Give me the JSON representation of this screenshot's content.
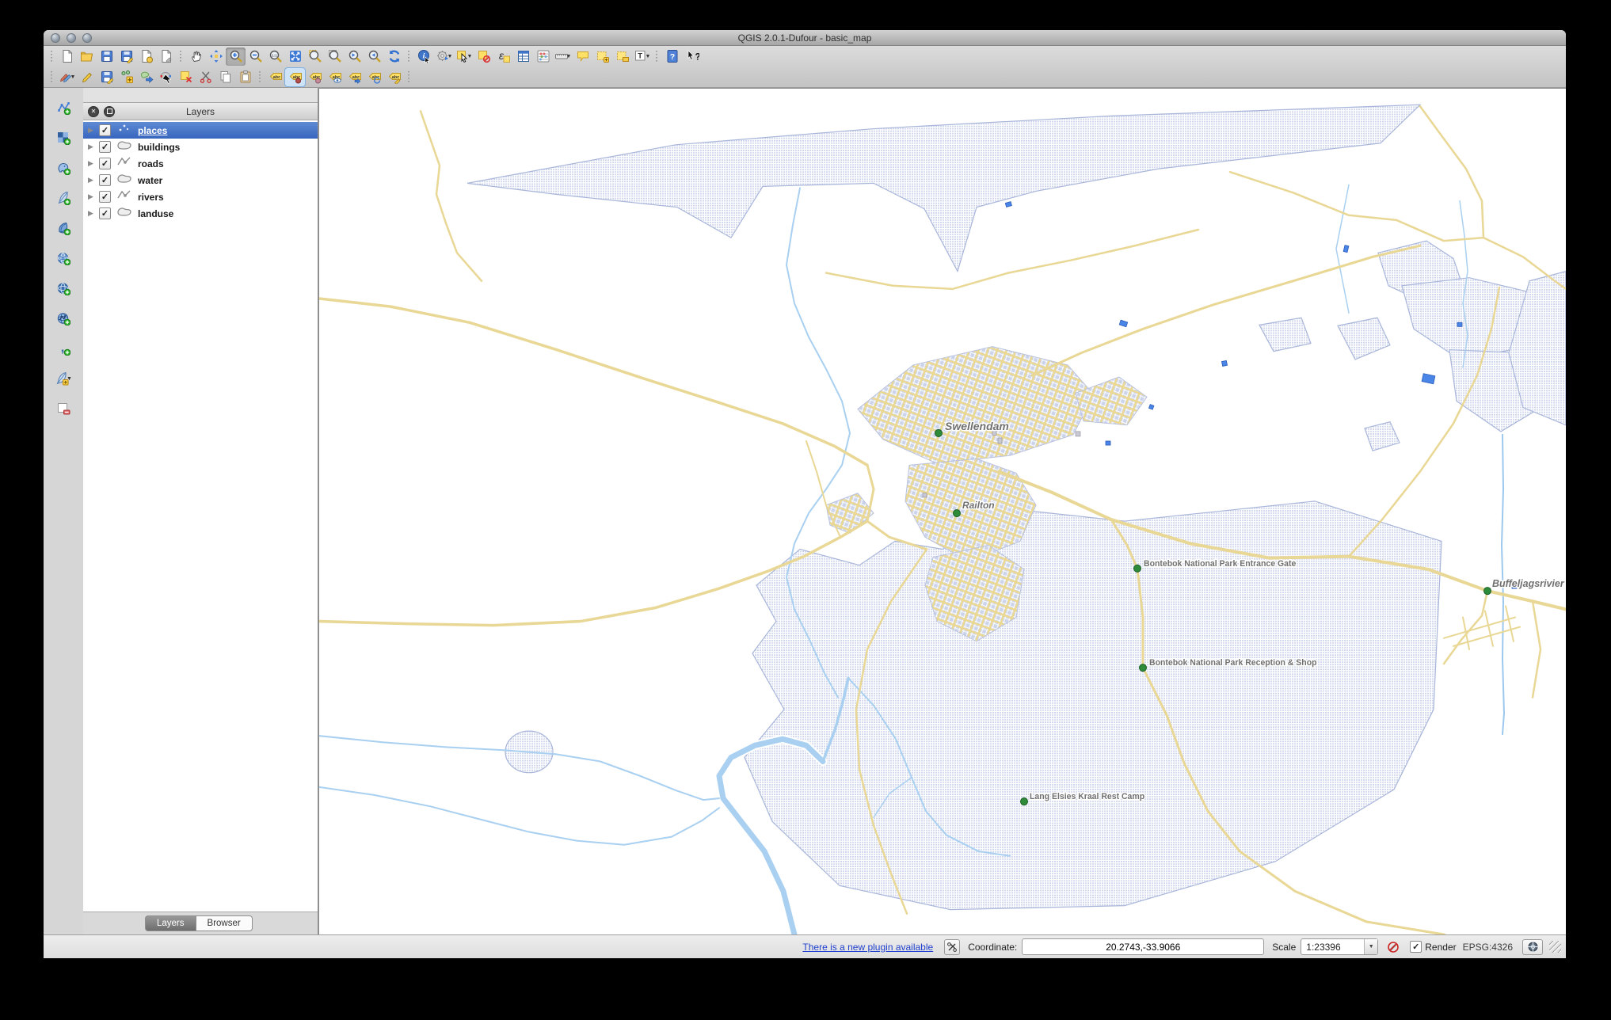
{
  "window": {
    "title": "QGIS 2.0.1-Dufour - basic_map"
  },
  "toolbars": {
    "row1": [
      {
        "grip": true
      },
      {
        "name": "new-project-icon"
      },
      {
        "name": "open-project-icon"
      },
      {
        "name": "save-project-icon"
      },
      {
        "name": "save-project-as-icon"
      },
      {
        "name": "new-composer-icon"
      },
      {
        "name": "composer-manager-icon"
      },
      {
        "grip": true
      },
      {
        "name": "pan-map-icon"
      },
      {
        "name": "pan-to-selection-icon"
      },
      {
        "name": "zoom-in-icon",
        "active": true
      },
      {
        "name": "zoom-out-icon"
      },
      {
        "name": "zoom-native-icon"
      },
      {
        "name": "zoom-full-icon"
      },
      {
        "name": "zoom-to-selection-icon"
      },
      {
        "name": "zoom-to-layer-icon"
      },
      {
        "name": "zoom-last-icon"
      },
      {
        "name": "zoom-next-icon"
      },
      {
        "name": "refresh-icon"
      },
      {
        "grip": true
      },
      {
        "name": "identify-icon"
      },
      {
        "name": "run-feature-action-icon",
        "dd": true
      },
      {
        "name": "select-features-icon",
        "dd": true
      },
      {
        "name": "deselect-features-icon"
      },
      {
        "name": "select-by-expression-icon"
      },
      {
        "name": "attribute-table-icon"
      },
      {
        "name": "field-calculator-icon"
      },
      {
        "name": "measure-icon",
        "dd": true
      },
      {
        "name": "map-tips-icon"
      },
      {
        "name": "new-bookmark-icon"
      },
      {
        "name": "show-bookmarks-icon"
      },
      {
        "name": "text-annotation-icon",
        "dd": true
      },
      {
        "grip": true
      },
      {
        "name": "help-icon"
      },
      {
        "name": "whats-this-icon"
      }
    ],
    "row2": [
      {
        "grip": true
      },
      {
        "name": "current-edits-icon",
        "dd": true
      },
      {
        "name": "toggle-editing-icon"
      },
      {
        "name": "save-layer-edits-icon"
      },
      {
        "name": "add-feature-icon"
      },
      {
        "name": "move-feature-icon"
      },
      {
        "name": "node-tool-icon"
      },
      {
        "name": "delete-selected-icon"
      },
      {
        "name": "cut-features-icon"
      },
      {
        "name": "copy-features-icon"
      },
      {
        "name": "paste-features-icon"
      },
      {
        "grip": true
      },
      {
        "name": "label-icon"
      },
      {
        "name": "pin-labels-icon",
        "active": true
      },
      {
        "name": "highlight-pinned-labels-icon"
      },
      {
        "name": "show-hide-labels-icon"
      },
      {
        "name": "move-label-icon"
      },
      {
        "name": "rotate-label-icon"
      },
      {
        "name": "change-label-icon"
      },
      {
        "grip": true
      }
    ],
    "left": [
      {
        "name": "add-vector-layer-icon"
      },
      {
        "name": "add-raster-layer-icon"
      },
      {
        "name": "add-postgis-layer-icon"
      },
      {
        "name": "add-spatialite-layer-icon"
      },
      {
        "name": "add-mssql-layer-icon"
      },
      {
        "name": "add-wms-layer-icon"
      },
      {
        "name": "add-wcs-layer-icon"
      },
      {
        "name": "add-wfs-layer-icon"
      },
      {
        "name": "add-delimited-text-layer-icon"
      },
      {
        "name": "new-shapefile-layer-icon",
        "dd": true
      },
      {
        "name": "remove-layer-icon"
      }
    ]
  },
  "layers_panel": {
    "title": "Layers",
    "layers": [
      {
        "label": "places",
        "type": "point",
        "checked": true,
        "selected": true
      },
      {
        "label": "buildings",
        "type": "polygon",
        "checked": true,
        "selected": false
      },
      {
        "label": "roads",
        "type": "line",
        "checked": true,
        "selected": false
      },
      {
        "label": "water",
        "type": "polygon",
        "checked": true,
        "selected": false
      },
      {
        "label": "rivers",
        "type": "line",
        "checked": true,
        "selected": false
      },
      {
        "label": "landuse",
        "type": "polygon",
        "checked": true,
        "selected": false
      }
    ],
    "tabs": [
      {
        "label": "Layers",
        "active": true
      },
      {
        "label": "Browser",
        "active": false
      }
    ]
  },
  "status_bar": {
    "plugin_link": "There is a new plugin available",
    "coordinate_label": "Coordinate:",
    "coordinate_value": "20.2743,-33.9066",
    "scale_label": "Scale",
    "scale_value": "1:23396",
    "render_label": "Render",
    "render_checked": true,
    "crs_text": "EPSG:4326"
  },
  "map": {
    "labels": [
      {
        "name": "swellendam",
        "text": "Swellendam"
      },
      {
        "name": "railton",
        "text": "Railton"
      },
      {
        "name": "entrance-gate",
        "text": "Bontebok National Park Entrance Gate"
      },
      {
        "name": "buffeljagsrivier",
        "text": "Buffeljagsrivier"
      },
      {
        "name": "reception-shop",
        "text": "Bontebok National Park Reception & Shop"
      },
      {
        "name": "rest-camp",
        "text": "Lang Elsies Kraal Rest Camp"
      }
    ],
    "colors": {
      "landuse_fill": "#ccd4ec",
      "landuse_border": "#a9b6da",
      "road": "#e9d795",
      "river": "#a9d0f0",
      "water": "#4a86e8",
      "label_text": "#707070",
      "place_marker": "#2e8b3a"
    }
  }
}
